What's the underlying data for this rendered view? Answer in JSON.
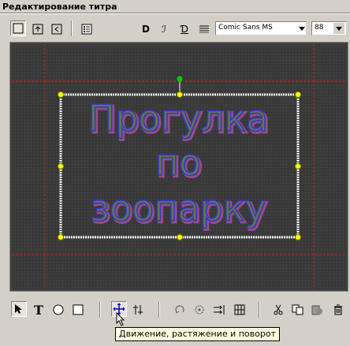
{
  "window": {
    "title": "Редактирование титра"
  },
  "toolbar": {
    "font_name": "Comic Sans MS",
    "font_size": "88",
    "bold_glyph": "D",
    "italic_glyph": "ℐ",
    "underline_glyph": "Ɗ"
  },
  "canvas": {
    "title_lines": [
      "Прогулка",
      "по",
      "зоопарку"
    ],
    "text_fill_color": "#5a7a4a",
    "text_outline_color": "#3a34c8",
    "text_shadow_color": "#b050a0",
    "guide_color": "#c82020",
    "handle_color": "#ffff00",
    "rotate_handle_color": "#00cc00"
  },
  "bottom_toolbar": {
    "text_tool_glyph": "T"
  },
  "tooltip": {
    "text": "Движение, растяжение и поворот"
  }
}
